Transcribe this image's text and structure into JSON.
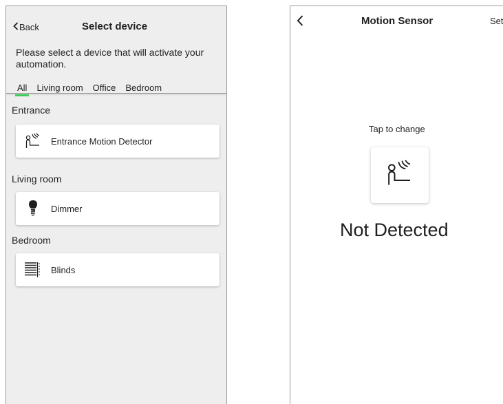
{
  "left_screen": {
    "back_label": "Back",
    "title": "Select device",
    "description": "Please select a device that will activate your automation.",
    "tabs": [
      "All",
      "Living room",
      "Office",
      "Bedroom"
    ],
    "active_tab": "All",
    "sections": [
      {
        "title": "Entrance",
        "devices": [
          {
            "label": "Entrance Motion Detector",
            "icon": "motion-sensor-icon"
          }
        ]
      },
      {
        "title": "Living room",
        "devices": [
          {
            "label": "Dimmer",
            "icon": "light-bulb-icon"
          }
        ]
      },
      {
        "title": "Bedroom",
        "devices": [
          {
            "label": "Blinds",
            "icon": "blinds-icon"
          }
        ]
      }
    ]
  },
  "right_screen": {
    "back_icon": "chevron-left-icon",
    "title": "Motion Sensor",
    "settings_label": "Set",
    "tap_hint": "Tap to change",
    "sensor_icon": "motion-sensor-icon",
    "status": "Not Detected"
  },
  "colors": {
    "accent": "#3dcd58",
    "panel_bg": "#eeeeee",
    "card_bg": "#ffffff"
  }
}
